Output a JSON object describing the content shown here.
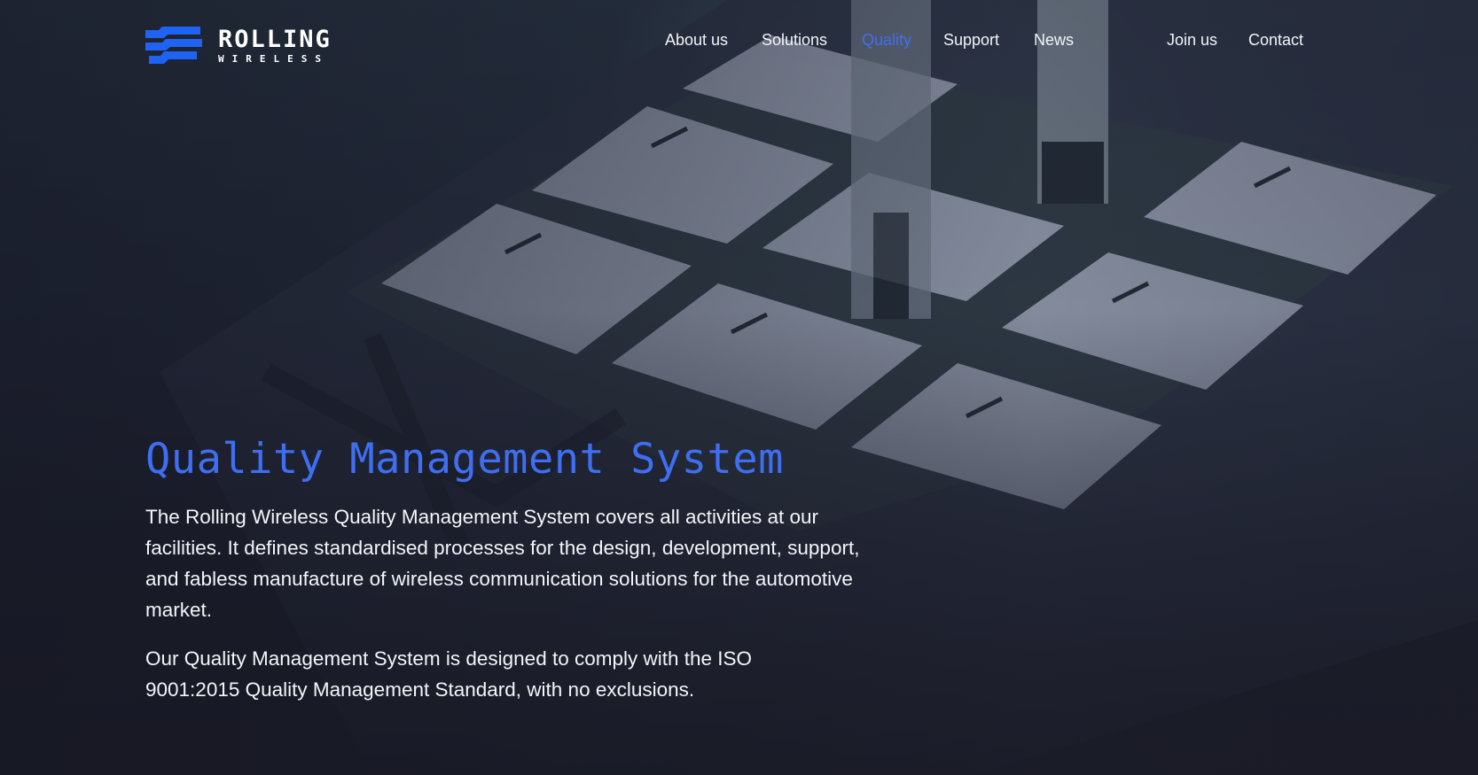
{
  "brand": {
    "name": "ROLLING",
    "subtitle": "WIRELESS",
    "accent_color": "#3f6ef2",
    "logo_icon": "stacked-bars-logo-icon"
  },
  "nav": {
    "items": [
      {
        "label": "About us",
        "active": false
      },
      {
        "label": "Solutions",
        "active": false
      },
      {
        "label": "Quality",
        "active": true
      },
      {
        "label": "Support",
        "active": false
      },
      {
        "label": "News",
        "active": false
      },
      {
        "label": "Join us",
        "active": false
      },
      {
        "label": "Contact",
        "active": false
      }
    ]
  },
  "hero": {
    "background": "chip-modules-tray-photo",
    "title": "Quality Management System",
    "paragraphs": [
      "The Rolling Wireless Quality Management System covers all activities at our facilities. It defines standardised processes for the design, development, support, and fabless manufacture of wireless communication solutions for the automotive market.",
      "Our Quality Management System is designed to comply with the ISO 9001:2015 Quality Management Standard, with no exclusions."
    ]
  }
}
